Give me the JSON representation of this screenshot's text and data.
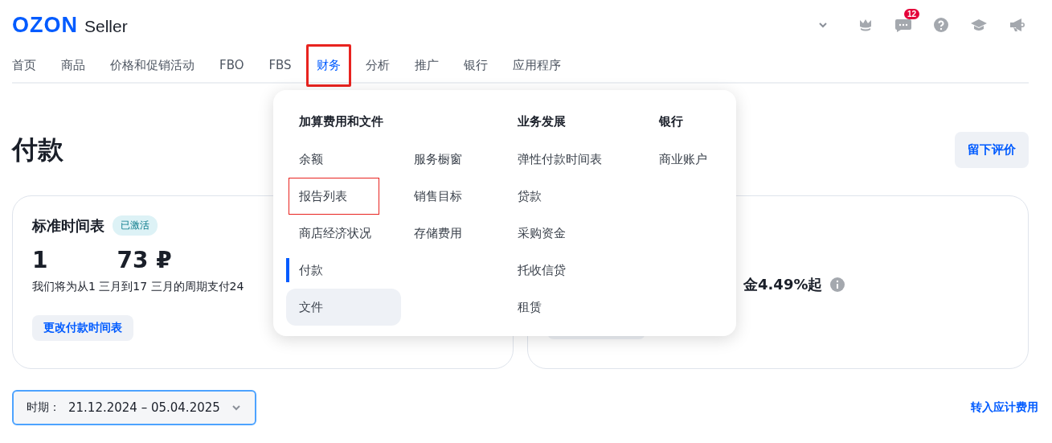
{
  "header": {
    "logo": "OZON",
    "product": "Seller",
    "notification_count": "12"
  },
  "nav": [
    {
      "label": "首页",
      "selected": false,
      "highlighted": false
    },
    {
      "label": "商品",
      "selected": false,
      "highlighted": false
    },
    {
      "label": "价格和促销活动",
      "selected": false,
      "highlighted": false
    },
    {
      "label": "FBO",
      "selected": false,
      "highlighted": false
    },
    {
      "label": "FBS",
      "selected": false,
      "highlighted": false
    },
    {
      "label": "财务",
      "selected": true,
      "highlighted": true
    },
    {
      "label": "分析",
      "selected": false,
      "highlighted": false
    },
    {
      "label": "推广",
      "selected": false,
      "highlighted": false
    },
    {
      "label": "银行",
      "selected": false,
      "highlighted": false
    },
    {
      "label": "应用程序",
      "selected": false,
      "highlighted": false
    }
  ],
  "page_title": "付款",
  "feedback_button": "留下评价",
  "schedule_card": {
    "title": "标准时间表",
    "badge": "已激活",
    "amount_1": "1",
    "amount_2": "73 ₽",
    "note": "我们将为从1 三月到17 三月的周期支付24",
    "button": "更改付款时间表"
  },
  "loan_card": {
    "text": "金4.49%起"
  },
  "period_select": {
    "label": "时期：",
    "value": "21.12.2024 – 05.04.2025"
  },
  "accruals_link": "转入应计费用",
  "menu": [
    {
      "heading": "加算费用和文件",
      "items": [
        {
          "label": "余额",
          "selected": false,
          "hovered": false,
          "highlighted": false
        },
        {
          "label": "报告列表",
          "selected": false,
          "hovered": false,
          "highlighted": true
        },
        {
          "label": "商店经济状况",
          "selected": false,
          "hovered": false,
          "highlighted": false
        },
        {
          "label": "付款",
          "selected": true,
          "hovered": false,
          "highlighted": false
        },
        {
          "label": "文件",
          "selected": false,
          "hovered": true,
          "highlighted": false
        },
        {
          "label": "服务橱窗",
          "selected": false,
          "hovered": false,
          "highlighted": false
        },
        {
          "label": "销售目标",
          "selected": false,
          "hovered": false,
          "highlighted": false
        },
        {
          "label": "存储费用",
          "selected": false,
          "hovered": false,
          "highlighted": false
        }
      ]
    },
    {
      "heading": "业务发展",
      "items": [
        {
          "label": "弹性付款时间表",
          "selected": false,
          "hovered": false,
          "highlighted": false
        },
        {
          "label": "贷款",
          "selected": false,
          "hovered": false,
          "highlighted": false
        },
        {
          "label": "采购资金",
          "selected": false,
          "hovered": false,
          "highlighted": false
        },
        {
          "label": "托收信贷",
          "selected": false,
          "hovered": false,
          "highlighted": false
        },
        {
          "label": "租赁",
          "selected": false,
          "hovered": false,
          "highlighted": false
        }
      ]
    },
    {
      "heading": "银行",
      "items": [
        {
          "label": "商业账户",
          "selected": false,
          "hovered": false,
          "highlighted": false
        }
      ]
    }
  ]
}
